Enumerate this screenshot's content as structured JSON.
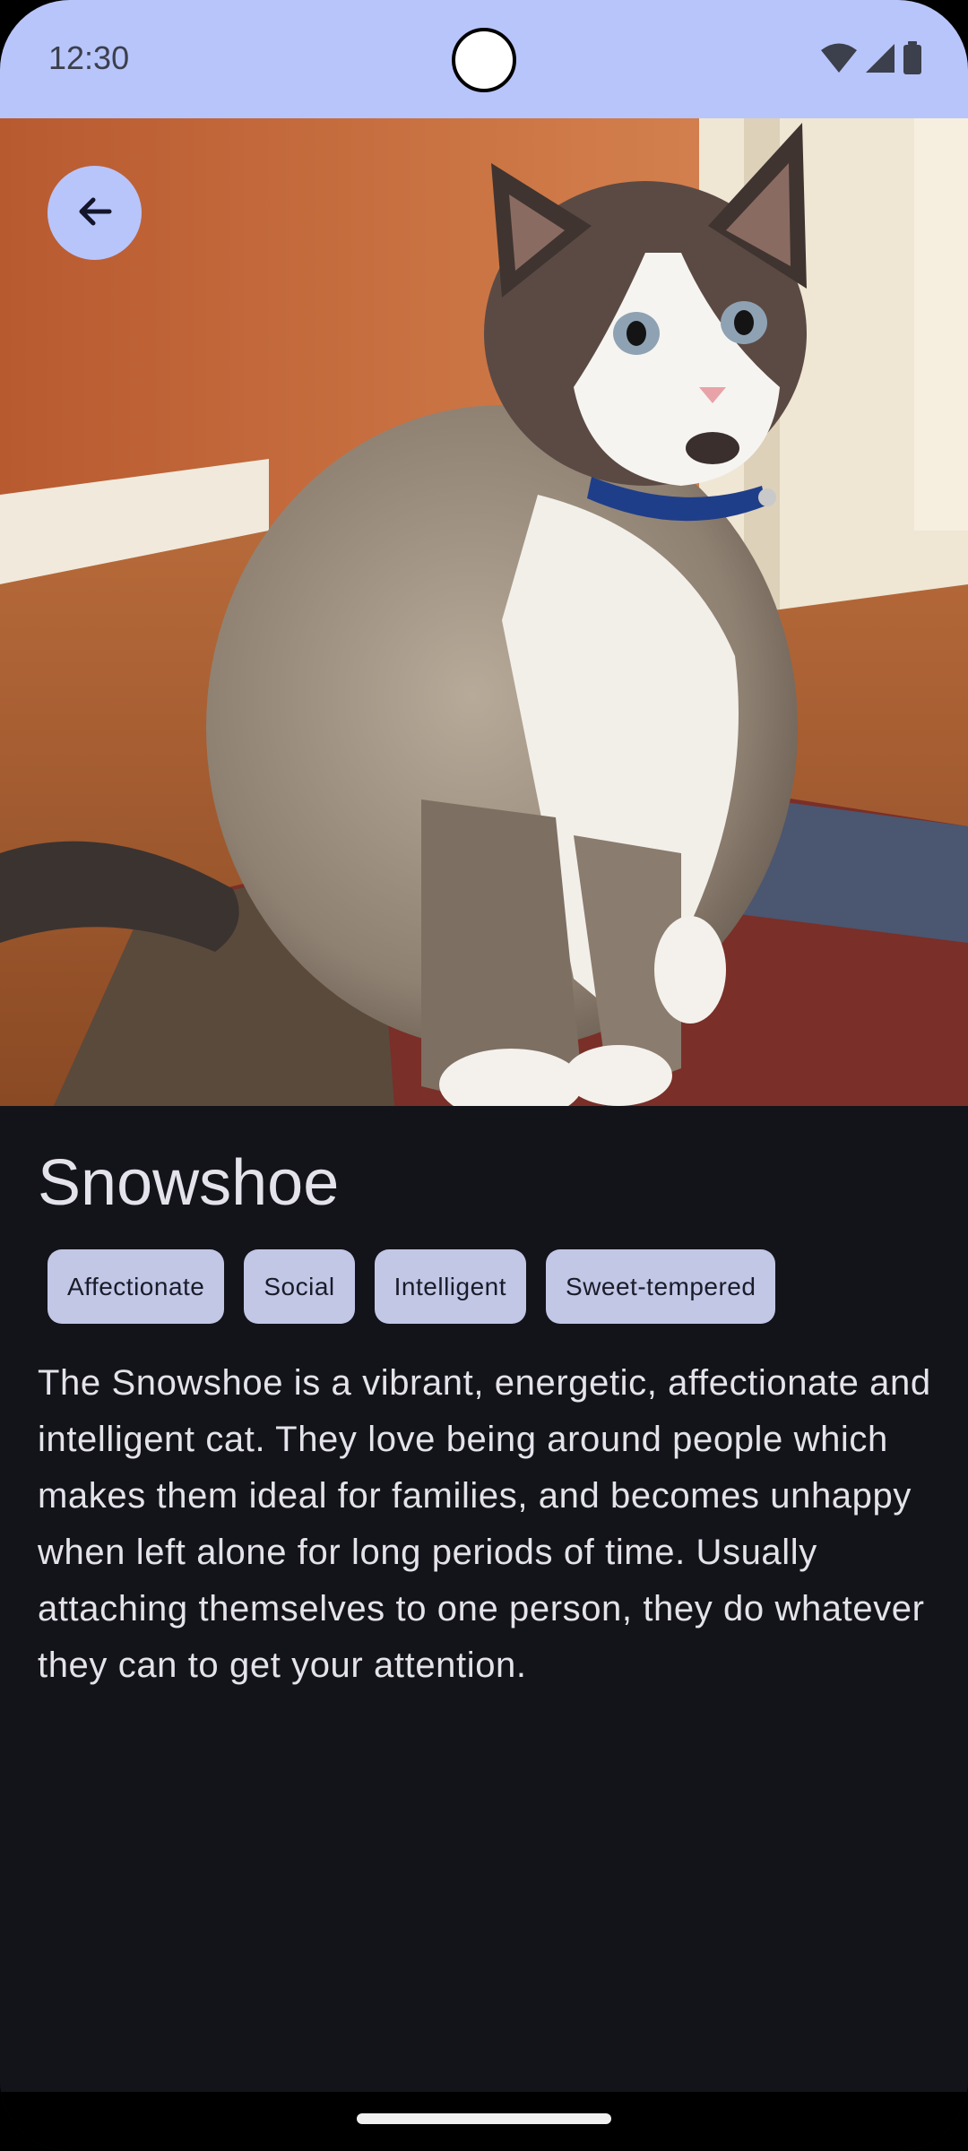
{
  "status_bar": {
    "time": "12:30",
    "icons": [
      "wifi-icon",
      "signal-icon",
      "battery-icon"
    ],
    "background": "#b8c5fb"
  },
  "header": {
    "back_icon": "arrow-back-icon"
  },
  "hero_image": {
    "subject": "cat-photo"
  },
  "breed": {
    "name": "Snowshoe",
    "traits": [
      "Affectionate",
      "Social",
      "Intelligent",
      "Sweet-tempered"
    ],
    "description": "The Snowshoe is a vibrant, energetic, affectionate and intelligent cat. They love being around people which makes them ideal for families, and becomes unhappy when left alone for long periods of time. Usually attaching themselves to one person, they do whatever they can to get your attention."
  },
  "colors": {
    "accent": "#b8c5fb",
    "chip": "#c2c7e6",
    "background": "#13141a",
    "text": "#e4e2ea"
  }
}
